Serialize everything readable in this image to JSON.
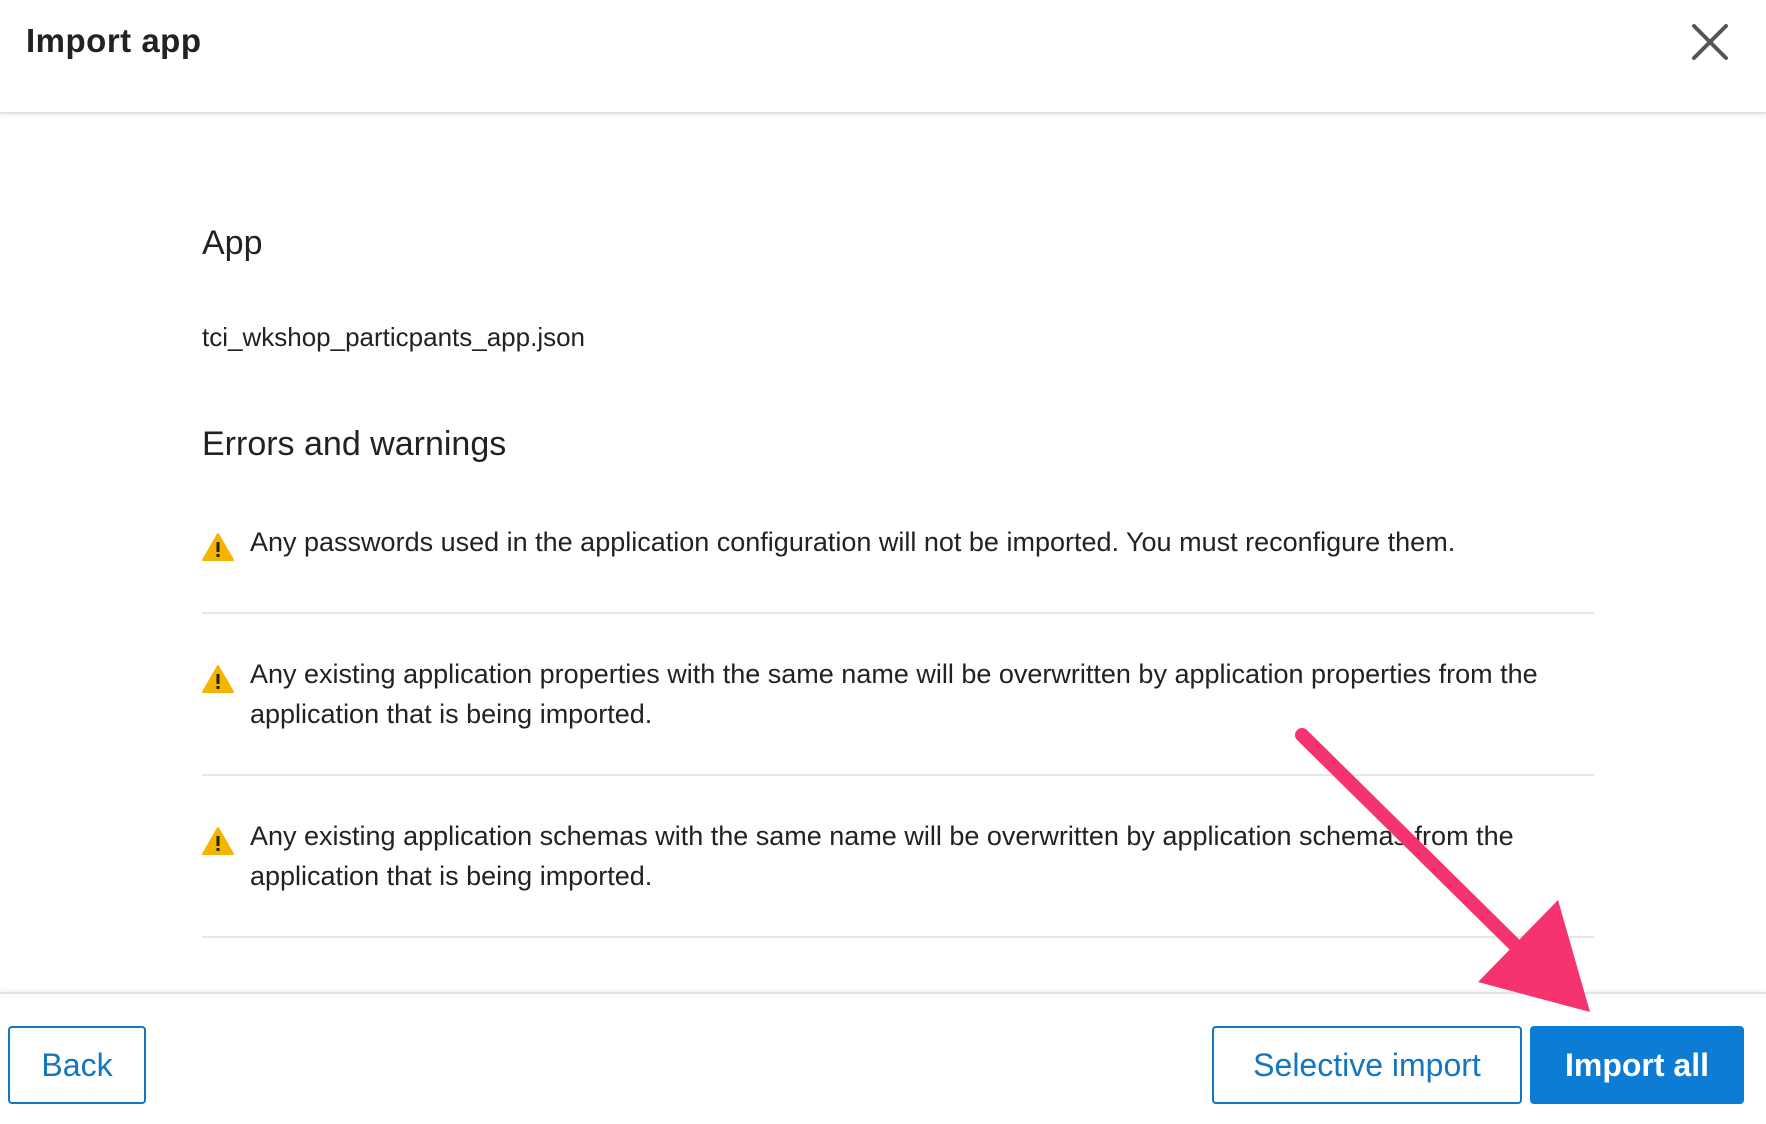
{
  "header": {
    "title": "Import app"
  },
  "app_section": {
    "heading": "App",
    "filename": "tci_wkshop_particpants_app.json"
  },
  "errors_section": {
    "heading": "Errors and warnings",
    "warnings": [
      {
        "text": "Any passwords used in the application configuration will not be imported. You must reconfigure them."
      },
      {
        "text": "Any existing application properties with the same name will be overwritten by application properties from the application that is being imported."
      },
      {
        "text": "Any existing application schemas with the same name will be overwritten by application schemas from the application that is being imported."
      }
    ]
  },
  "footer": {
    "back_label": "Back",
    "selective_import_label": "Selective import",
    "import_all_label": "Import all"
  },
  "colors": {
    "accent": "#0c7cd5",
    "warning": "#f5b400",
    "annotation_arrow": "#f5346f"
  },
  "icons": {
    "close": "close-icon",
    "warning": "warning-icon"
  }
}
